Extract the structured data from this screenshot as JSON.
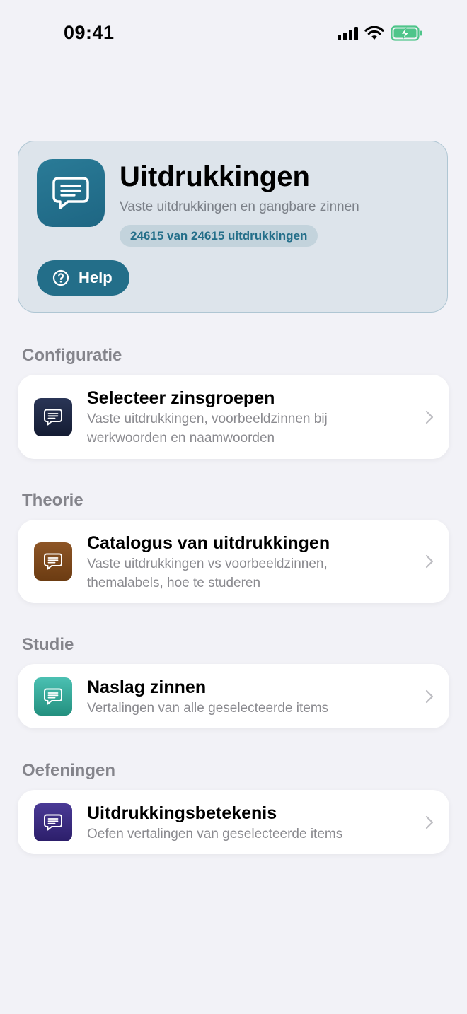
{
  "status_bar": {
    "time": "09:41"
  },
  "header": {
    "title": "Uitdrukkingen",
    "subtitle": "Vaste uitdrukkingen en gangbare zinnen",
    "count_badge": "24615 van 24615 uitdrukkingen",
    "help_label": "Help",
    "icon": "chat-bubble-icon",
    "accent_color": "#236E89"
  },
  "sections": [
    {
      "title": "Configuratie",
      "item": {
        "title": "Selecteer zinsgroepen",
        "subtitle": "Vaste uitdrukkingen, voorbeeldzinnen bij werkwoorden en naamwoorden",
        "icon_color": "#1B2644"
      }
    },
    {
      "title": "Theorie",
      "item": {
        "title": "Catalogus van uitdrukkingen",
        "subtitle": "Vaste uitdrukkingen vs voorbeeldzinnen, themalabels, hoe te studeren",
        "icon_color": "#7A4718"
      }
    },
    {
      "title": "Studie",
      "item": {
        "title": "Naslag zinnen",
        "subtitle": "Vertalingen van alle geselecteerde items",
        "icon_color": "#2FA59A"
      }
    },
    {
      "title": "Oefeningen",
      "item": {
        "title": "Uitdrukkingsbetekenis",
        "subtitle": "Oefen vertalingen van geselecteerde items",
        "icon_color": "#3A2B7E"
      }
    }
  ]
}
